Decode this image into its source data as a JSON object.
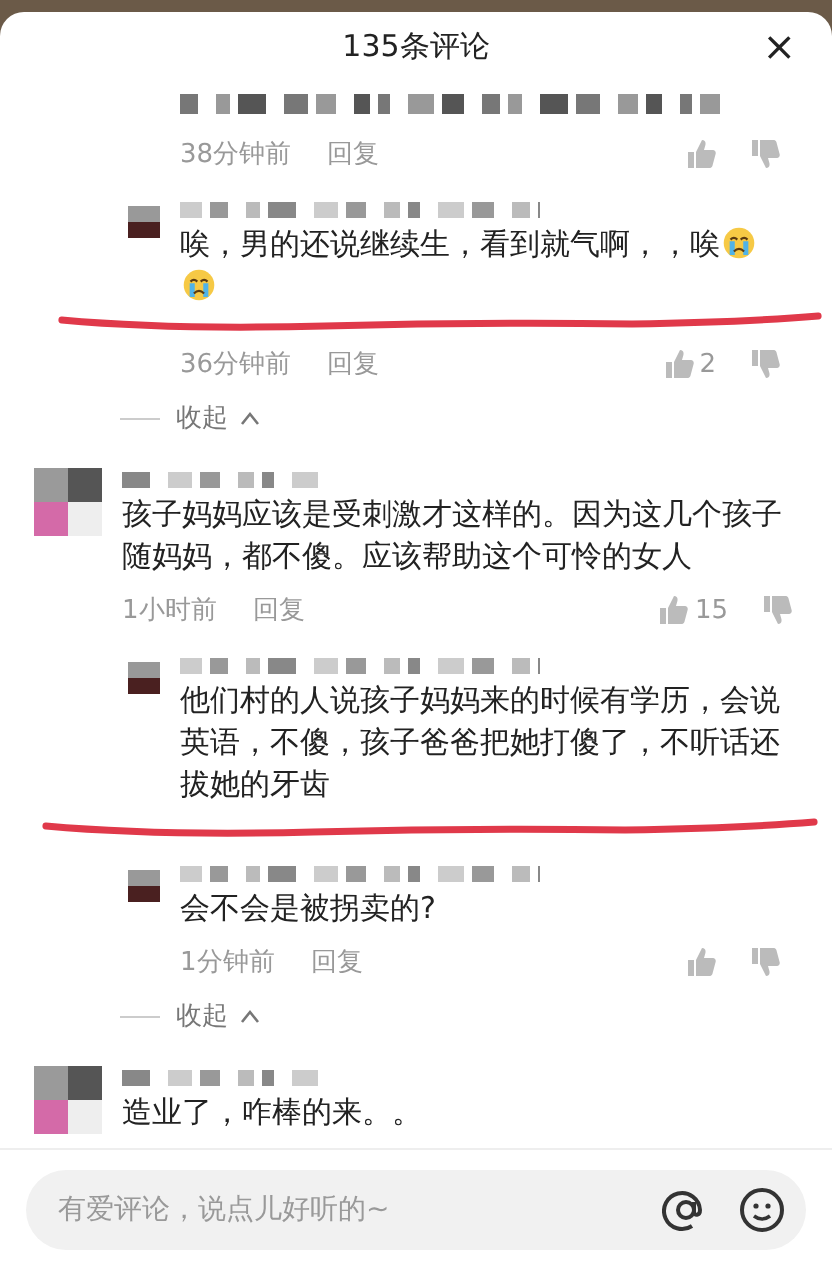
{
  "header": {
    "title": "135条评论",
    "close": "×"
  },
  "items": [
    {
      "kind": "reply",
      "cut": true,
      "time": "38分钟前",
      "action": "回复"
    },
    {
      "kind": "reply",
      "text": "唉，男的还说继续生，看到就气啊，，唉",
      "emojis": [
        {
          "kind": "crying"
        },
        {
          "kind": "crying"
        }
      ],
      "underlined": true,
      "time": "36分钟前",
      "action": "回复",
      "likes": "2"
    },
    {
      "kind": "collapse",
      "label": "收起"
    },
    {
      "kind": "comment",
      "text": "孩子妈妈应该是受刺激才这样的。因为这几个孩子随妈妈，都不傻。应该帮助这个可怜的女人",
      "time": "1小时前",
      "action": "回复",
      "likes": "15"
    },
    {
      "kind": "reply",
      "text": "他们村的人说孩子妈妈来的时候有学历，会说英语，不傻，孩子爸爸把她打傻了，不听话还拔她的牙齿",
      "underlined": true
    },
    {
      "kind": "reply",
      "text": "会不会是被拐卖的?",
      "time": "1分钟前",
      "action": "回复"
    },
    {
      "kind": "collapse",
      "label": "收起"
    },
    {
      "kind": "comment",
      "text": "造业了，咋棒的来。。"
    }
  ],
  "input": {
    "placeholder": "有爱评论，说点儿好听的~"
  }
}
